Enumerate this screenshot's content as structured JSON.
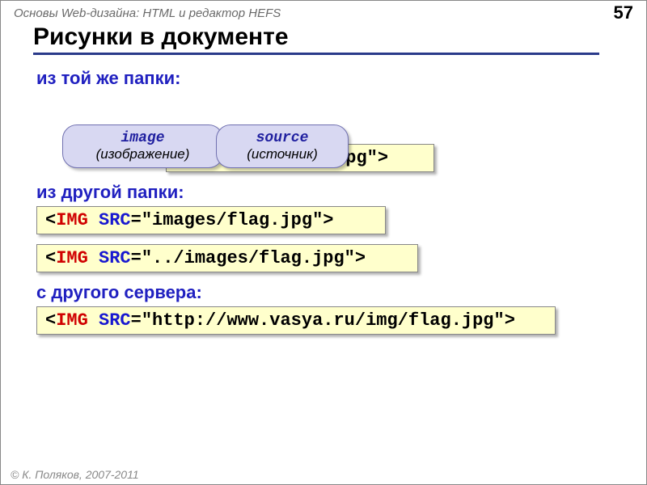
{
  "header": {
    "title": "Основы Web-дизайна: HTML и редактор HEFS",
    "page": "57"
  },
  "title": "Рисунки в документе",
  "sections": {
    "same": "из той же папки:",
    "other": "из другой папки:",
    "server": "с другого сервера:"
  },
  "callouts": {
    "image": {
      "top": "image",
      "bottom": "(изображение)"
    },
    "source": {
      "top": "source",
      "bottom": "(источник)"
    }
  },
  "code": {
    "lt": "<",
    "gt": ">",
    "tag": "IMG",
    "attr": "SRC",
    "eq": "=",
    "v1": "\"flag.jpg\"",
    "v2": "\"images/flag.jpg\"",
    "v3": "\"../images/flag.jpg\"",
    "v4": "\"http://www.vasya.ru/img/flag.jpg\""
  },
  "footer": "© К. Поляков, 2007-2011"
}
